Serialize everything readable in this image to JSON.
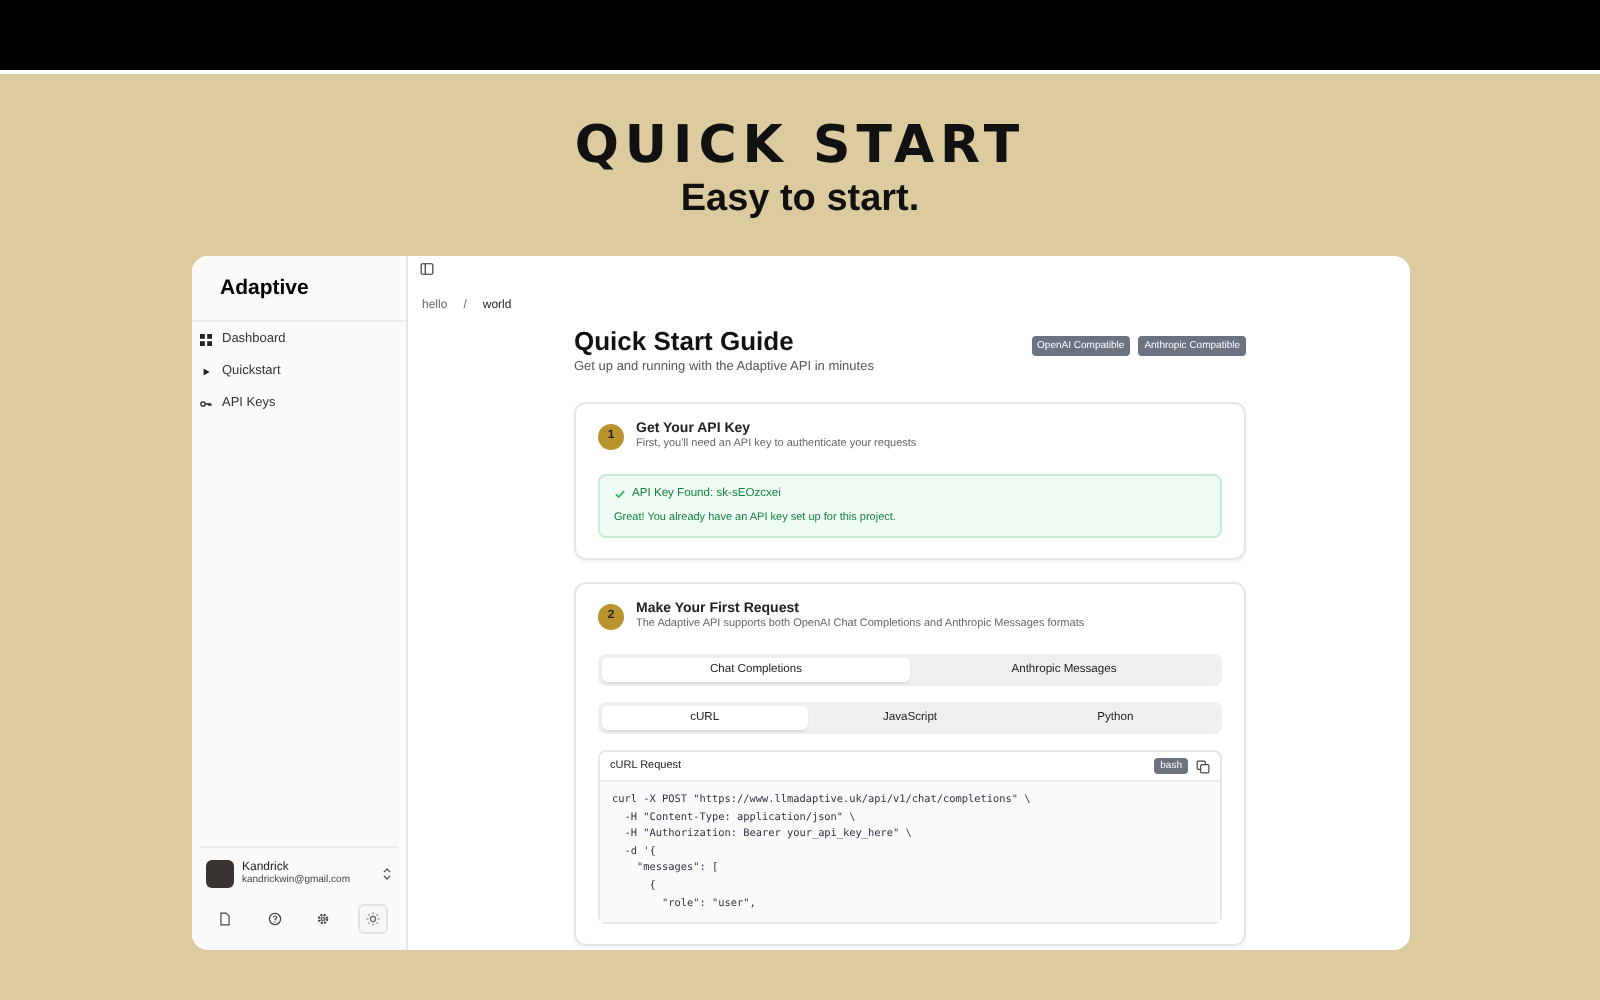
{
  "header": {
    "title": "QUICK START",
    "subtitle": "Easy to start."
  },
  "sidebar": {
    "logo": "Adaptive",
    "items": [
      {
        "label": "Dashboard",
        "kind": "grid",
        "selected": false
      },
      {
        "label": "Quickstart",
        "kind": "play",
        "selected": false
      },
      {
        "label": "API Keys",
        "kind": "key",
        "selected": false
      }
    ],
    "user": {
      "name": "Kandrick",
      "email": "kandrickwin@gmail.com"
    },
    "footer_icons": [
      {
        "kind": "document",
        "selected": false
      },
      {
        "kind": "help",
        "selected": false
      },
      {
        "kind": "gear",
        "selected": false
      },
      {
        "kind": "sun",
        "selected": true
      }
    ]
  },
  "breadcrumb": [
    {
      "kind": "link",
      "text": "hello"
    },
    {
      "kind": "separator",
      "text": "/"
    },
    {
      "kind": "current",
      "text": "world"
    }
  ],
  "guide": {
    "title": "Quick Start Guide",
    "subtitle": "Get up and running with the Adaptive API in minutes",
    "badges": [
      "OpenAI Compatible",
      "Anthropic Compatible"
    ]
  },
  "step1": {
    "number": "1",
    "title": "Get Your API Key",
    "description": "First, you'll need an API key to authenticate your requests",
    "alert_title": "API Key Found: sk-sEOzcxei",
    "alert_text": "Great! You already have an API key set up for this project."
  },
  "step2": {
    "number": "2",
    "title": "Make Your First Request",
    "description": "The Adaptive API supports both OpenAI Chat Completions and Anthropic Messages formats",
    "format_tabs": [
      {
        "label": "Chat Completions",
        "selected": true
      },
      {
        "label": "Anthropic Messages",
        "selected": false
      }
    ],
    "language_tabs": [
      {
        "label": "cURL",
        "selected": true
      },
      {
        "label": "JavaScript",
        "selected": false
      },
      {
        "label": "Python",
        "selected": false
      }
    ],
    "code_title": "cURL Request",
    "code_language": "bash",
    "code_lines": [
      "curl -X POST \"https://www.llmadaptive.uk/api/v1/chat/completions\" \\",
      "  -H \"Content-Type: application/json\" \\",
      "  -H \"Authorization: Bearer your_api_key_here\" \\",
      "  -d '{",
      "    \"messages\": [",
      "      {",
      "        \"role\": \"user\","
    ]
  }
}
